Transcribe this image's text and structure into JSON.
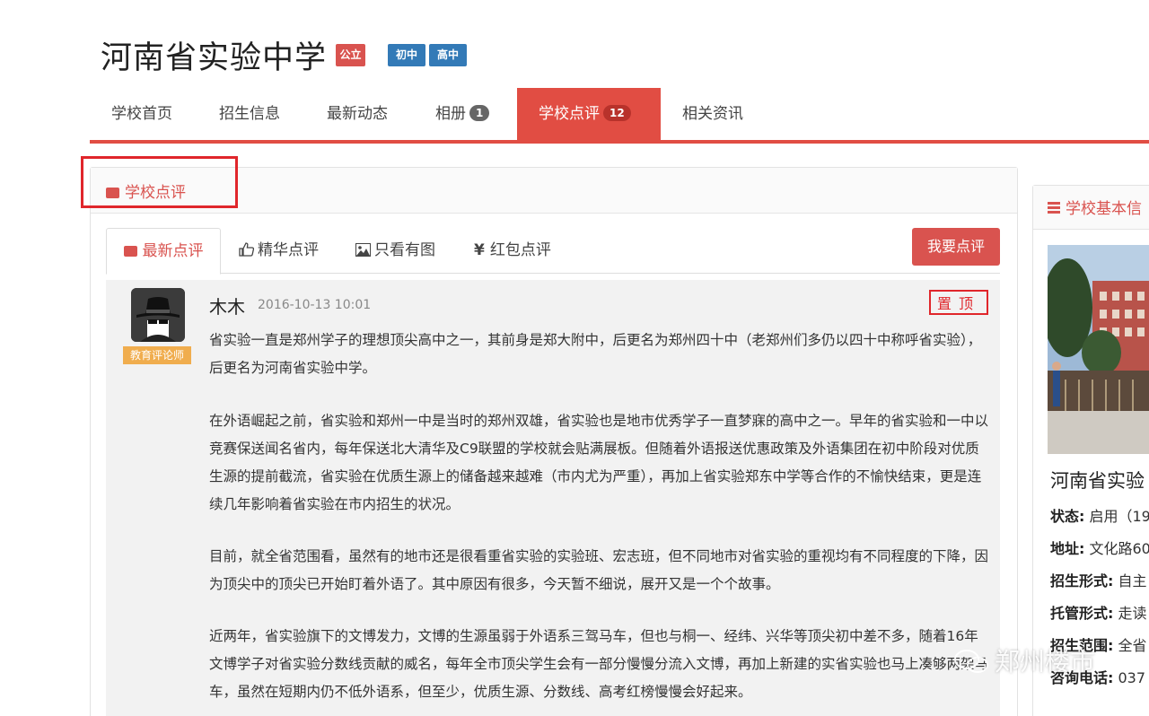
{
  "school": {
    "name": "河南省实验中学",
    "badges": {
      "type": "公立",
      "junior": "初中",
      "senior": "高中"
    }
  },
  "nav": {
    "items": [
      {
        "label": "学校首页"
      },
      {
        "label": "招生信息"
      },
      {
        "label": "最新动态"
      },
      {
        "label": "相册",
        "count": "1"
      },
      {
        "label": "学校点评",
        "count": "12",
        "active": true
      },
      {
        "label": "相关资讯"
      }
    ]
  },
  "review_panel": {
    "title": "学校点评",
    "tabs": [
      {
        "label": "最新点评",
        "icon": "chat-icon",
        "active": true
      },
      {
        "label": "精华点评",
        "icon": "thumbs-up-icon"
      },
      {
        "label": "只看有图",
        "icon": "image-icon"
      },
      {
        "label": "红包点评",
        "icon": "yen-icon"
      }
    ],
    "write_button": "我要点评"
  },
  "review": {
    "author": "木木",
    "date": "2016-10-13 10:01",
    "role": "教育评论师",
    "stamp": "置顶",
    "paragraphs": [
      "省实验一直是郑州学子的理想顶尖高中之一，其前身是郑大附中，后更名为郑州四十中（老郑州们多仍以四十中称呼省实验），后更名为河南省实验中学。",
      "在外语崛起之前，省实验和郑州一中是当时的郑州双雄，省实验也是地市优秀学子一直梦寐的高中之一。早年的省实验和一中以竞赛保送闻名省内，每年保送北大清华及C9联盟的学校就会贴满展板。但随着外语报送优惠政策及外语集团在初中阶段对优质生源的提前截流，省实验在优质生源上的储备越来越难（市内尤为严重），再加上省实验郑东中学等合作的不愉快结束，更是连续几年影响着省实验在市内招生的状况。",
      "目前，就全省范围看，虽然有的地市还是很看重省实验的实验班、宏志班，但不同地市对省实验的重视均有不同程度的下降，因为顶尖中的顶尖已开始盯着外语了。其中原因有很多，今天暂不细说，展开又是一个个故事。",
      "近两年，省实验旗下的文博发力，文博的生源虽弱于外语系三驾马车，但也与桐一、经纬、兴华等顶尖初中差不多，随着16年文博学子对省实验分数线贡献的威名，每年全市顶尖学生会有一部分慢慢分流入文博，再加上新建的实省实验也马上凑够两架马车，虽然在短期内仍不低外语系，但至少，优质生源、分数线、高考红榜慢慢会好起来。"
    ]
  },
  "sidebar": {
    "title": "学校基本信",
    "school_name": "河南省实验",
    "fields": [
      {
        "label": "状态:",
        "value": "启用（19"
      },
      {
        "label": "地址:",
        "value": "文化路60"
      },
      {
        "label": "招生形式:",
        "value": "自主"
      },
      {
        "label": "托管形式:",
        "value": "走读"
      },
      {
        "label": "招生范围:",
        "value": "全省"
      },
      {
        "label": "咨询电话:",
        "value": "037"
      }
    ]
  },
  "watermark": "郑州楼市",
  "colors": {
    "accent": "#e14d43",
    "blue": "#337ab7",
    "orange": "#f0ad4e"
  }
}
